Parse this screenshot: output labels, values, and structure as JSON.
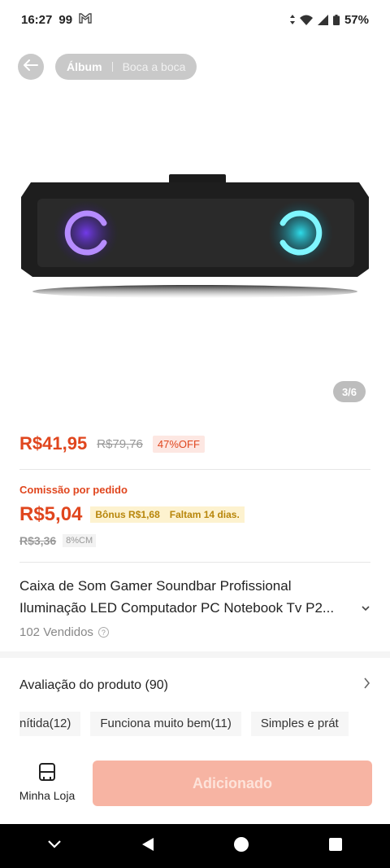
{
  "status_bar": {
    "time": "16:27",
    "notif_count": "99",
    "battery": "57%"
  },
  "top_nav": {
    "tab_album": "Álbum",
    "tab_reviews": "Boca a boca"
  },
  "image": {
    "counter": "3/6"
  },
  "price": {
    "current": "R$41,95",
    "original": "R$79,76",
    "discount": "47%OFF"
  },
  "commission": {
    "label": "Comissão por pedido",
    "value": "R$5,04",
    "bonus": "Bônus R$1,68",
    "remaining": "Faltam 14 dias.",
    "old_value": "R$3,36",
    "rate": "8%CM"
  },
  "product": {
    "title": "Caixa de Som Gamer Soundbar Profissional Iluminação LED Computador PC Notebook Tv P2...",
    "sold": "102 Vendidos"
  },
  "reviews": {
    "header": "Avaliação do produto (90)",
    "tags": [
      "nítida(12)",
      "Funciona muito bem(11)",
      "Simples e prát"
    ]
  },
  "bottom_bar": {
    "store_label": "Minha Loja",
    "add_label": "Adicionado"
  },
  "colors": {
    "accent": "#e0461e",
    "add_button": "#f7b4a3"
  }
}
